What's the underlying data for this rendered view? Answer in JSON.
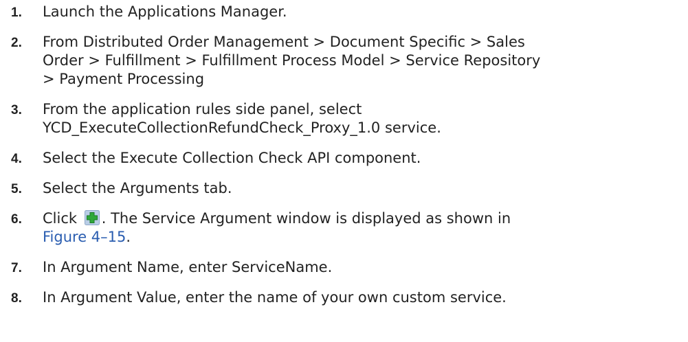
{
  "steps": [
    {
      "number": "1.",
      "lines": [
        "Launch the Applications Manager."
      ]
    },
    {
      "number": "2.",
      "lines": [
        "From Distributed Order Management > Document Specific > Sales",
        "Order > Fulfillment > Fulfillment Process Model > Service Repository",
        "> Payment Processing"
      ]
    },
    {
      "number": "3.",
      "lines": [
        "From the application rules side panel, select",
        "YCD_ExecuteCollectionRefundCheck_Proxy_1.0 service."
      ]
    },
    {
      "number": "4.",
      "lines": [
        "Select the Execute Collection Check API component."
      ]
    },
    {
      "number": "5.",
      "lines": [
        "Select the Arguments tab."
      ]
    },
    {
      "number": "6.",
      "before_icon": "Click",
      "icon": "add-icon",
      "after_icon": ". The Service Argument window is displayed as shown in",
      "link": "Figure 4–15",
      "after_link": "."
    },
    {
      "number": "7.",
      "lines": [
        "In Argument Name, enter ServiceName."
      ]
    },
    {
      "number": "8.",
      "lines": [
        "In Argument Value, enter the name of your own custom service."
      ]
    }
  ],
  "colors": {
    "text": "#222222",
    "link": "#2a5db0",
    "icon_green": "#2fa83a",
    "icon_bg": "#b9cde6"
  }
}
